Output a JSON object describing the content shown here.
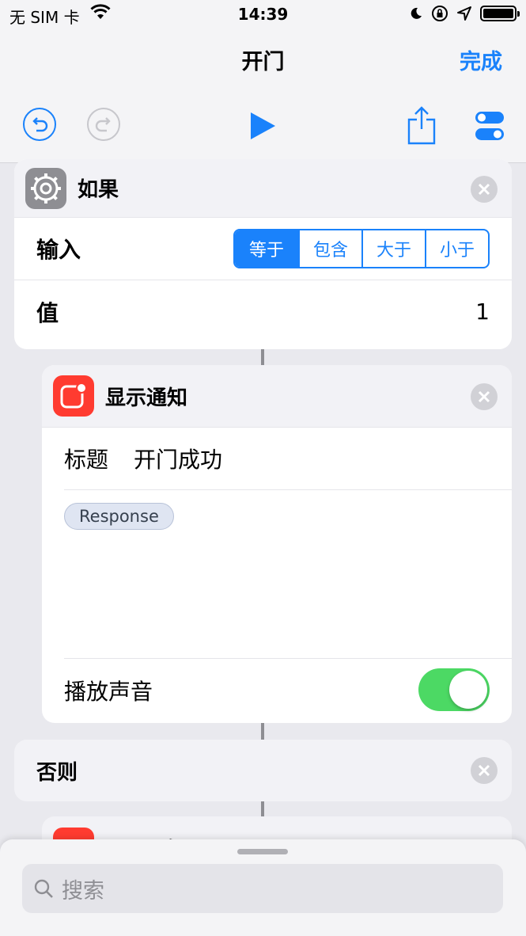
{
  "status_bar": {
    "carrier": "无 SIM 卡",
    "time": "14:39"
  },
  "nav": {
    "title": "开门",
    "done_label": "完成"
  },
  "if_block": {
    "label": "如果",
    "input_label": "输入",
    "segments": [
      "等于",
      "包含",
      "大于",
      "小于"
    ],
    "selected_segment": "等于",
    "value_label": "值",
    "value": "1"
  },
  "notification_block": {
    "label": "显示通知",
    "title_label": "标题",
    "title_value": "开门成功",
    "variable_chip": "Response",
    "sound_label": "播放声音",
    "sound_on": true
  },
  "else_block": {
    "label": "否则"
  },
  "next_block": {
    "label": "显示通知"
  },
  "search": {
    "placeholder": "搜索"
  },
  "colors": {
    "accent": "#1a82fb",
    "toggle_on": "#4cd964",
    "notify_red": "#ff3b30"
  }
}
